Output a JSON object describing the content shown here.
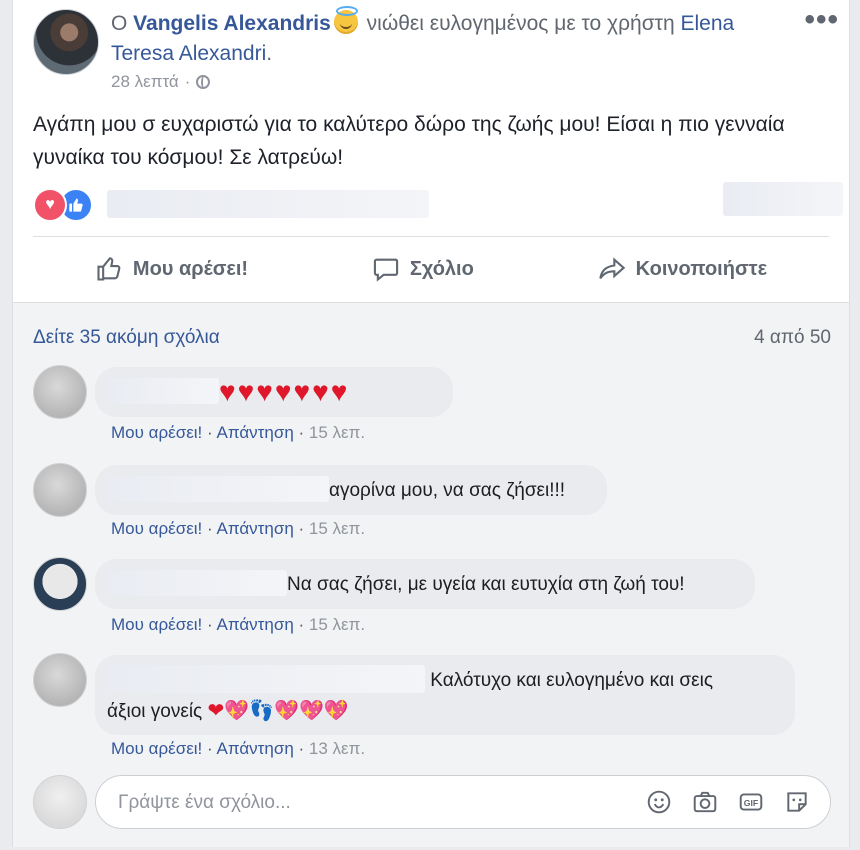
{
  "post": {
    "prefix": "Ο ",
    "author": "Vangelis Alexandris",
    "feeling_text": " νιώθει ευλογημένος με το χρήστη ",
    "tagged_user": "Elena Teresa Alexandri",
    "period": ".",
    "time": "28 λεπτά",
    "separator": "·",
    "body": "Αγάπη μου σ ευχαριστώ για το καλύτερο δώρο της ζωής μου! Είσαι η πιο γενναία γυναίκα του κόσμου! Σε λατρεύω!",
    "more_label": "•••"
  },
  "actions": {
    "like": "Μου αρέσει!",
    "comment": "Σχόλιο",
    "share": "Κοινοποιήστε"
  },
  "comments_header": {
    "view_more": "Δείτε 35 ακόμη σχόλια",
    "count": "4 από 50"
  },
  "comment_actions": {
    "like": "Μου αρέσει!",
    "dot": "·",
    "reply": "Απάντηση"
  },
  "comments": [
    {
      "text": "♥♥♥♥♥♥♥",
      "time": "15 λεπ."
    },
    {
      "text": "αγορίνα μου, να σας ζήσει!!!",
      "time": "15 λεπ."
    },
    {
      "text": "Να σας ζήσει, με υγεία και ευτυχία στη ζωή του!",
      "time": "15 λεπ."
    },
    {
      "text_line1": "Καλότυχο και ευλογημένο και σεις",
      "text_line2": "άξιοι γονείς",
      "emoji": "❤💖👣💖💖💖",
      "time": "13 λεπ."
    }
  ],
  "composer": {
    "placeholder": "Γράψτε ένα σχόλιο..."
  },
  "icons": [
    "heart-reaction-icon",
    "like-reaction-icon",
    "thumbs-up-icon",
    "comment-icon",
    "share-icon",
    "globe-icon",
    "emoji-icon",
    "camera-icon",
    "gif-icon",
    "sticker-icon"
  ]
}
